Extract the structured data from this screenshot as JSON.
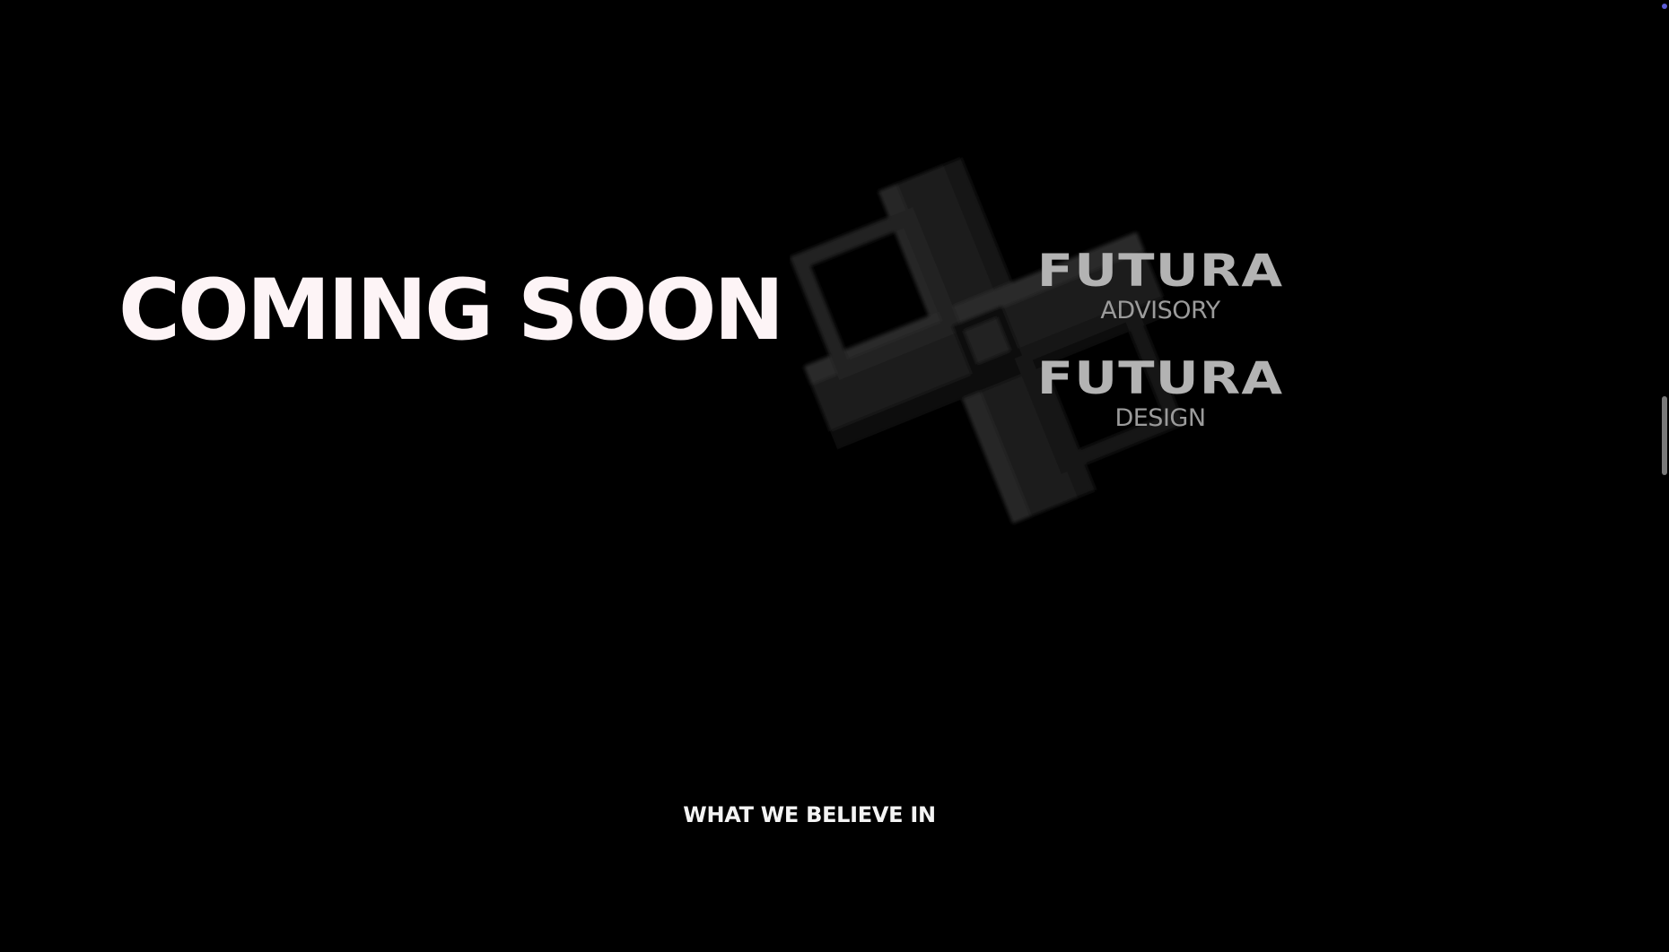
{
  "hero": {
    "headline": "COMING SOON"
  },
  "brands": [
    {
      "name": "FUTURA",
      "division": "ADVISORY"
    },
    {
      "name": "FUTURA",
      "division": "DESIGN"
    }
  ],
  "section": {
    "heading": "WHAT WE BELIEVE IN"
  },
  "decor": {
    "emblem_icon": "abstract-3d-cross-icon"
  },
  "colors": {
    "background": "#000000",
    "headline": "#fdf4f6",
    "brand_name": "#b3b3b3",
    "brand_sub": "#9b9b9b",
    "emblem": "#1e1e1e"
  }
}
